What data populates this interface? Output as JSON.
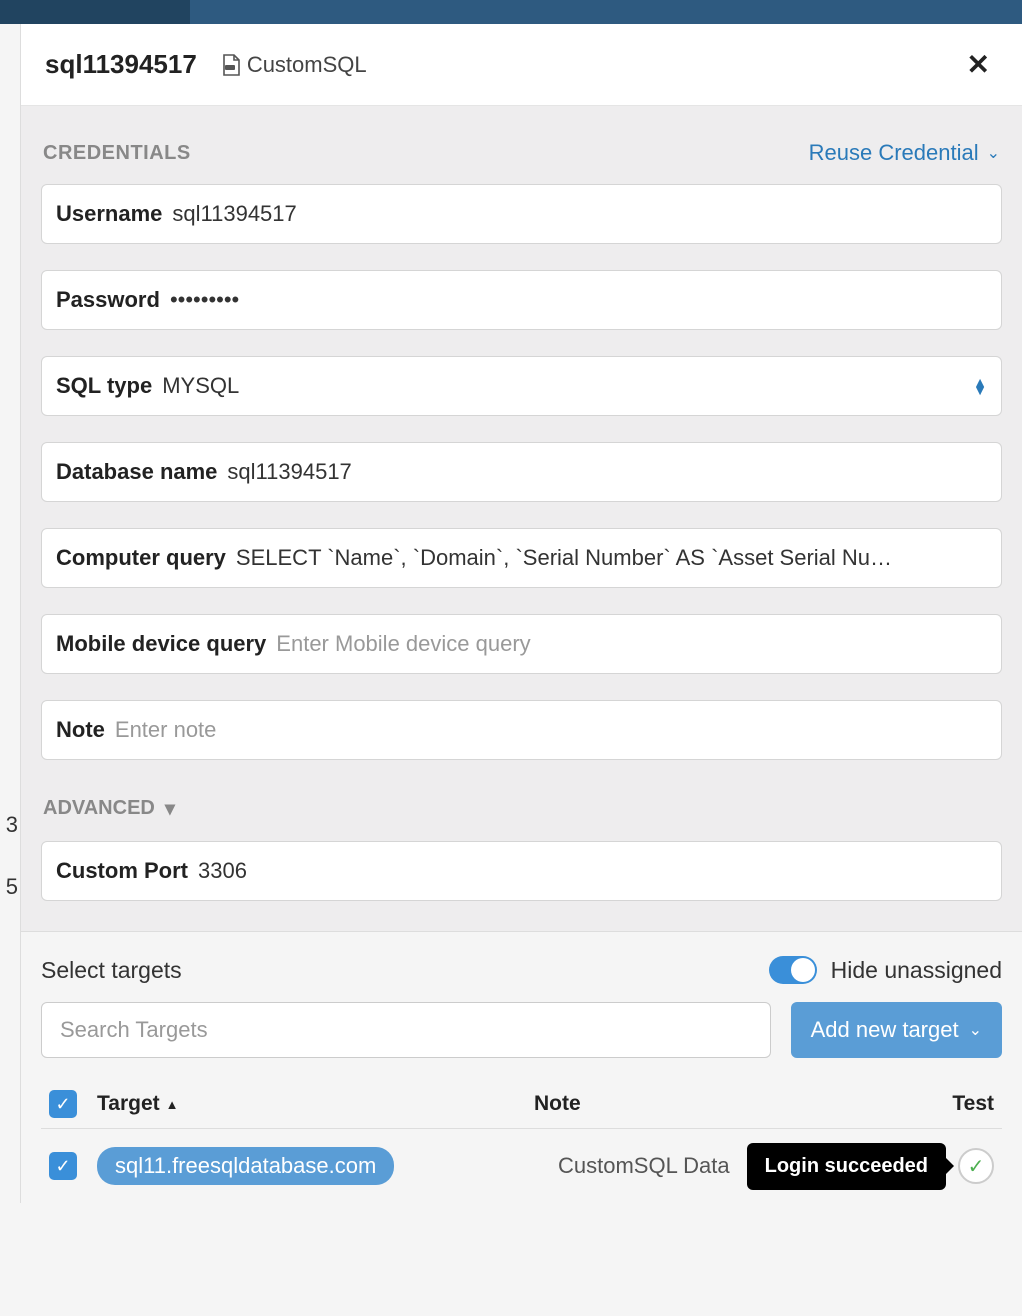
{
  "header": {
    "title": "sql11394517",
    "type_label": "CustomSQL"
  },
  "sections": {
    "credentials_label": "CREDENTIALS",
    "reuse_label": "Reuse Credential",
    "advanced_label": "ADVANCED"
  },
  "fields": {
    "username": {
      "label": "Username",
      "value": "sql11394517"
    },
    "password": {
      "label": "Password",
      "value": "•••••••••"
    },
    "sql_type": {
      "label": "SQL type",
      "value": "MYSQL"
    },
    "database_name": {
      "label": "Database name",
      "value": "sql11394517"
    },
    "computer_query": {
      "label": "Computer query",
      "value": "SELECT `Name`, `Domain`, `Serial Number` AS `Asset Serial Nu…"
    },
    "mobile_query": {
      "label": "Mobile device query",
      "placeholder": "Enter Mobile device query"
    },
    "note": {
      "label": "Note",
      "placeholder": "Enter note"
    },
    "custom_port": {
      "label": "Custom Port",
      "value": "3306"
    }
  },
  "targets": {
    "title": "Select targets",
    "hide_unassigned_label": "Hide unassigned",
    "search_placeholder": "Search Targets",
    "add_button": "Add new target",
    "columns": {
      "target": "Target",
      "note": "Note",
      "test": "Test"
    },
    "rows": [
      {
        "target": "sql11.freesqldatabase.com",
        "note": "CustomSQL Data",
        "checked": true
      }
    ],
    "tooltip": "Login succeeded"
  },
  "left_hints": {
    "a": "3",
    "b": "5"
  }
}
